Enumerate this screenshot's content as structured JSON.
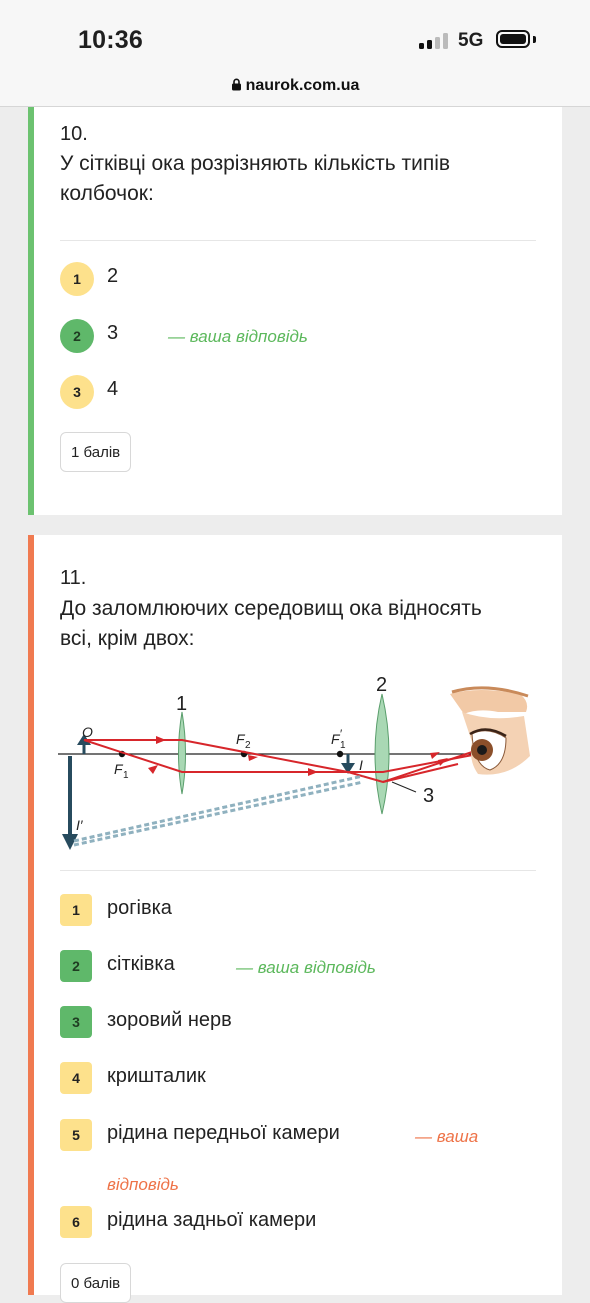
{
  "status": {
    "time": "10:36",
    "network": "5G",
    "url": "naurok.com.ua"
  },
  "colors": {
    "correct": "#5cb85c",
    "wrong": "#ee7348",
    "neutral_badge": "#fde18c",
    "correct_badge": "#5fb86a"
  },
  "q10": {
    "number": "10.",
    "text": "У сітківці ока розрізняють кількість типів колбочок:",
    "options": [
      {
        "num": "1",
        "label": "2",
        "state": "neutral"
      },
      {
        "num": "2",
        "label": "3",
        "state": "correct"
      },
      {
        "num": "3",
        "label": "4",
        "state": "neutral"
      }
    ],
    "your_answer": "— ваша відповідь",
    "points": "1 балів"
  },
  "q11": {
    "number": "11.",
    "text": "До заломлюючих середовищ ока відносять всі, крім двох:",
    "diagram": {
      "label_lens1": "1",
      "label_lens2": "2",
      "label_ray": "3",
      "label_O": "O",
      "label_F1": "F",
      "label_F1_sub": "1",
      "label_F2": "F",
      "label_F2_sub": "2",
      "label_F1p": "F",
      "label_F1p_sub": "1",
      "label_F1p_prime": "′",
      "label_I": "I",
      "label_Ip": "I′"
    },
    "options": [
      {
        "num": "1",
        "label": "рогівка",
        "state": "neutral"
      },
      {
        "num": "2",
        "label": "сітківка",
        "state": "correct"
      },
      {
        "num": "3",
        "label": "зоровий нерв",
        "state": "correct"
      },
      {
        "num": "4",
        "label": "кришталик",
        "state": "neutral"
      },
      {
        "num": "5",
        "label": "рідина передньої камери",
        "state": "neutral"
      },
      {
        "num": "6",
        "label": "рідина задньої камери",
        "state": "neutral"
      }
    ],
    "your_answer_correct": "— ваша відповідь",
    "your_answer_wrong_1": "— ваша",
    "your_answer_wrong_2": "відповідь",
    "points": "0 балів"
  }
}
